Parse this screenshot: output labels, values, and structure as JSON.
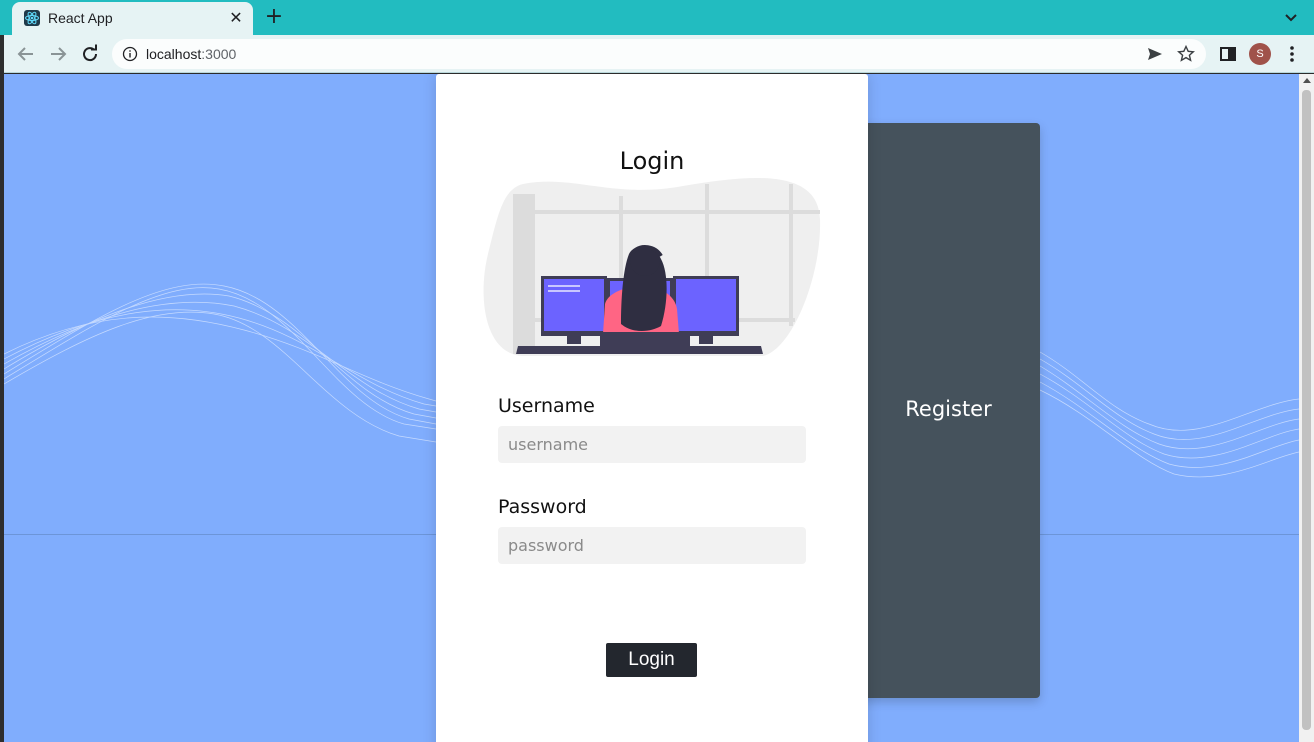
{
  "browser": {
    "tab_title": "React App",
    "tab_close": "✕",
    "new_tab": "+",
    "url_host": "localhost",
    "url_port": ":3000",
    "profile_initial": "S",
    "accent_color": "#22bcc0"
  },
  "page": {
    "background_color": "#80adfd",
    "login": {
      "title": "Login",
      "username_label": "Username",
      "username_placeholder": "username",
      "username_value": "",
      "password_label": "Password",
      "password_placeholder": "password",
      "password_value": "",
      "submit_label": "Login"
    },
    "register": {
      "label": "Register",
      "panel_color": "#45525c"
    }
  },
  "icons": {
    "favicon": "react-logo-icon",
    "back": "arrow-left-icon",
    "forward": "arrow-right-icon",
    "reload": "reload-icon",
    "site_info": "info-icon",
    "send": "send-icon",
    "bookmark": "star-icon",
    "side_panel": "side-panel-icon",
    "menu": "kebab-menu-icon",
    "tabs_dropdown": "chevron-down-icon"
  }
}
